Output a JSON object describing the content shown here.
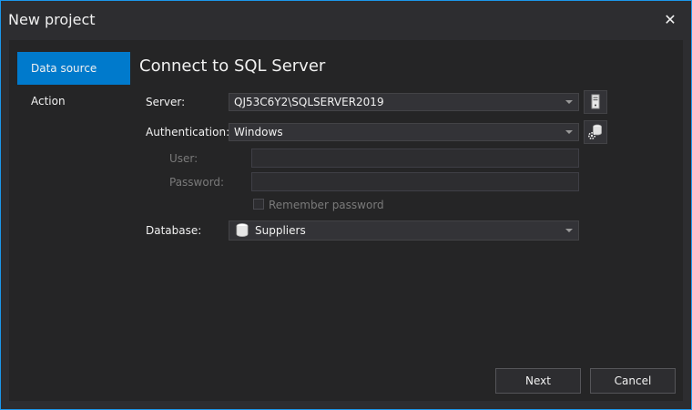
{
  "window": {
    "title": "New project"
  },
  "nav": {
    "items": [
      {
        "label": "Data source",
        "active": true
      },
      {
        "label": "Action",
        "active": false
      }
    ]
  },
  "main": {
    "heading": "Connect to SQL Server",
    "server": {
      "label": "Server:",
      "value": "QJ53C6Y2\\SQLSERVER2019"
    },
    "authentication": {
      "label": "Authentication:",
      "value": "Windows"
    },
    "user": {
      "label": "User:",
      "value": ""
    },
    "password": {
      "label": "Password:",
      "value": ""
    },
    "remember": {
      "label": "Remember password",
      "checked": false
    },
    "database": {
      "label": "Database:",
      "value": "Suppliers"
    }
  },
  "footer": {
    "next_label": "Next",
    "cancel_label": "Cancel"
  },
  "colors": {
    "accent": "#007acc",
    "border": "#1c97ea",
    "background": "#2d2d30"
  }
}
